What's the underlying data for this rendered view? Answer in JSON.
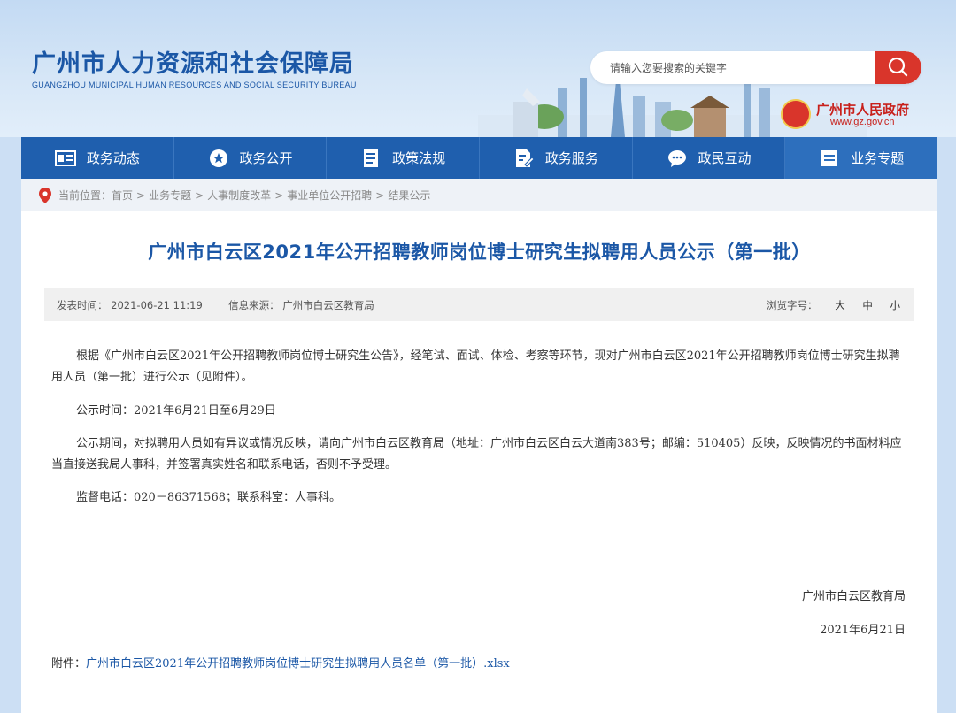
{
  "header": {
    "logo_cn": "广州市人力资源和社会保障局",
    "logo_en": "GUANGZHOU MUNICIPAL HUMAN RESOURCES AND SOCIAL SECURITY BUREAU",
    "search_placeholder": "请输入您要搜索的关键字",
    "gov_badge_cn": "广州市人民政府",
    "gov_badge_url": "www.gz.gov.cn"
  },
  "nav": {
    "items": [
      {
        "label": "政务动态",
        "icon": "news-icon"
      },
      {
        "label": "政务公开",
        "icon": "star-icon"
      },
      {
        "label": "政策法规",
        "icon": "document-icon"
      },
      {
        "label": "政务服务",
        "icon": "service-icon"
      },
      {
        "label": "政民互动",
        "icon": "chat-icon"
      },
      {
        "label": "业务专题",
        "icon": "topic-icon"
      }
    ]
  },
  "breadcrumb": {
    "prefix": "当前位置：",
    "items": [
      "首页",
      "业务专题",
      "人事制度改革",
      "事业单位公开招聘",
      "结果公示"
    ]
  },
  "article": {
    "title": "广州市白云区2021年公开招聘教师岗位博士研究生拟聘用人员公示（第一批）",
    "publish_label": "发表时间：",
    "publish_time": "2021-06-21 11:19",
    "source_label": "信息来源：",
    "source": "广州市白云区教育局",
    "font_size_label": "浏览字号：",
    "font_sizes": [
      "大",
      "中",
      "小"
    ],
    "paragraphs": [
      "根据《广州市白云区2021年公开招聘教师岗位博士研究生公告》，经笔试、面试、体检、考察等环节，现对广州市白云区2021年公开招聘教师岗位博士研究生拟聘用人员（第一批）进行公示（见附件）。",
      "公示时间：2021年6月21日至6月29日",
      "公示期间，对拟聘用人员如有异议或情况反映，请向广州市白云区教育局（地址：广州市白云区白云大道南383号；邮编：510405）反映，反映情况的书面材料应当直接送我局人事科，并签署真实姓名和联系电话，否则不予受理。",
      "监督电话：020－86371568；联系科室：人事科。"
    ],
    "sign_org": "广州市白云区教育局",
    "sign_date": "2021年6月21日",
    "attachment_label": "附件：",
    "attachment_link": "广州市白云区2021年公开招聘教师岗位博士研究生拟聘用人员名单（第一批）.xlsx"
  },
  "colors": {
    "brand_blue": "#1b57a6",
    "nav_blue": "#1f5fae",
    "search_red": "#d9352b"
  }
}
